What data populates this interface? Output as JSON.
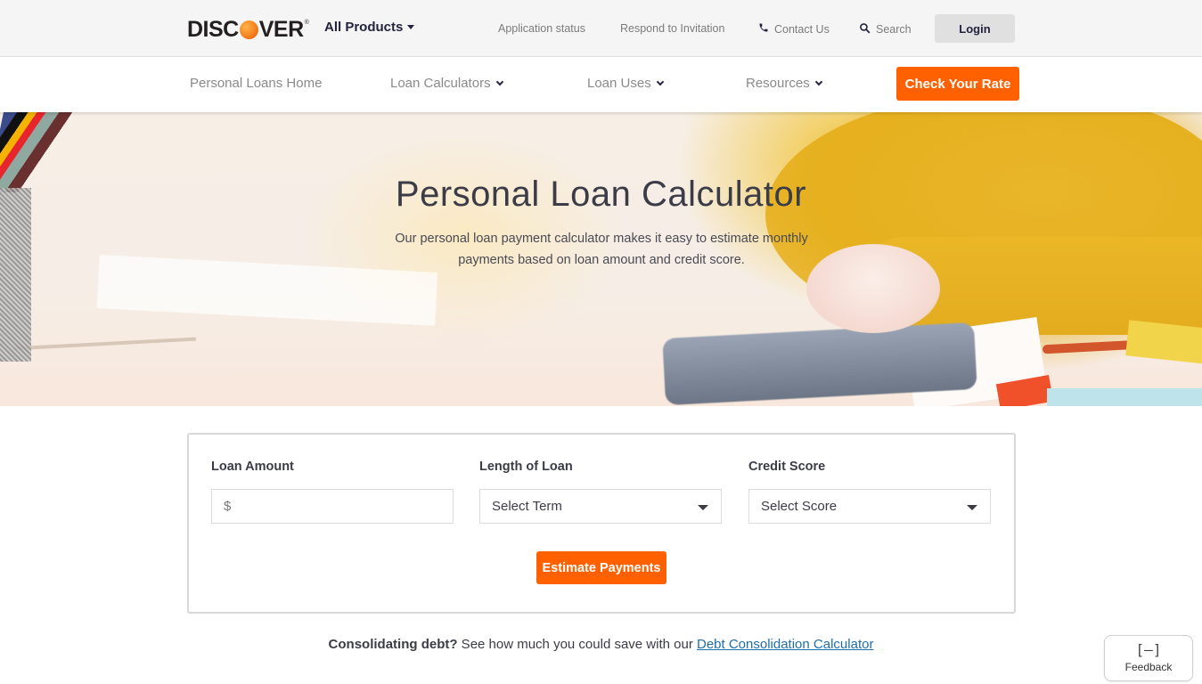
{
  "brand": {
    "logo_left": "DISC",
    "logo_right": "VER",
    "logo_reg": "®",
    "accent_color": "#ff6000"
  },
  "utility_bar": {
    "all_products": "All Products",
    "links": {
      "application_status": "Application status",
      "respond_to_invitation": "Respond to Invitation",
      "contact_us": "Contact Us",
      "search": "Search"
    },
    "icons": {
      "phone": "phone-icon",
      "search": "search-icon"
    },
    "login": "Login"
  },
  "main_nav": {
    "items": [
      {
        "label": "Personal Loans Home",
        "has_dropdown": false
      },
      {
        "label": "Loan Calculators",
        "has_dropdown": true
      },
      {
        "label": "Loan Uses",
        "has_dropdown": true
      },
      {
        "label": "Resources",
        "has_dropdown": true
      }
    ],
    "cta": "Check Your Rate"
  },
  "hero": {
    "title": "Personal Loan Calculator",
    "subtitle": "Our personal loan payment calculator makes it easy to estimate monthly payments based on loan amount and credit score."
  },
  "calculator": {
    "loan_amount": {
      "label": "Loan Amount",
      "prefix": "$",
      "value": ""
    },
    "length_of_loan": {
      "label": "Length of Loan",
      "selected": "Select Term"
    },
    "credit_score": {
      "label": "Credit Score",
      "selected": "Select Score"
    },
    "submit": "Estimate Payments"
  },
  "consolidation": {
    "bold": "Consolidating debt?",
    "text": " See how much you could save with our ",
    "link": "Debt Consolidation Calculator"
  },
  "feedback": {
    "icon": "[–]",
    "label": "Feedback"
  }
}
